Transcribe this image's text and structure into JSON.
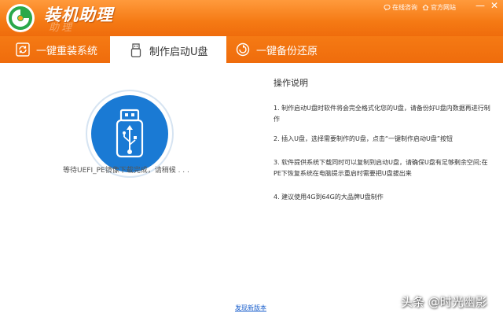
{
  "app": {
    "title": "装机助理",
    "title_ghost": "助理"
  },
  "title_links": [
    {
      "label": "在线咨询",
      "icon": "chat-icon"
    },
    {
      "label": "官方网站",
      "icon": "home-icon"
    }
  ],
  "window_controls": {
    "minimize": "—",
    "close": "✕"
  },
  "tabs": [
    {
      "label": "一键重装系统",
      "icon": "refresh-icon",
      "active": false
    },
    {
      "label": "制作启动U盘",
      "icon": "usb-drive-icon",
      "active": true
    },
    {
      "label": "一键备份还原",
      "icon": "restore-icon",
      "active": false
    }
  ],
  "status": {
    "text": "等待UEFI_PE镜像下载完成，请稍候 . . ."
  },
  "instructions": {
    "title": "操作说明",
    "steps": [
      "1.  制作启动U盘时软件将会完全格式化您的U盘，请备份好U盘内数据再进行制作",
      "2.  插入U盘，选择需要制作的U盘，点击“一键制作启动U盘”按钮",
      "3.  软件提供系统下载同时可以复制到启动U盘，请确保U盘有足够剩余空间;在PE下恢复系统在电脑提示重启时需要把U盘拔出来",
      "4.  建议使用4G到64G的大品牌U盘制作"
    ]
  },
  "footer": {
    "link": "发现新版本"
  },
  "watermark": "头条 @时光幽影",
  "colors": {
    "accent": "#f57a14",
    "blue": "#1a7ad4",
    "link": "#1a5fcc"
  }
}
